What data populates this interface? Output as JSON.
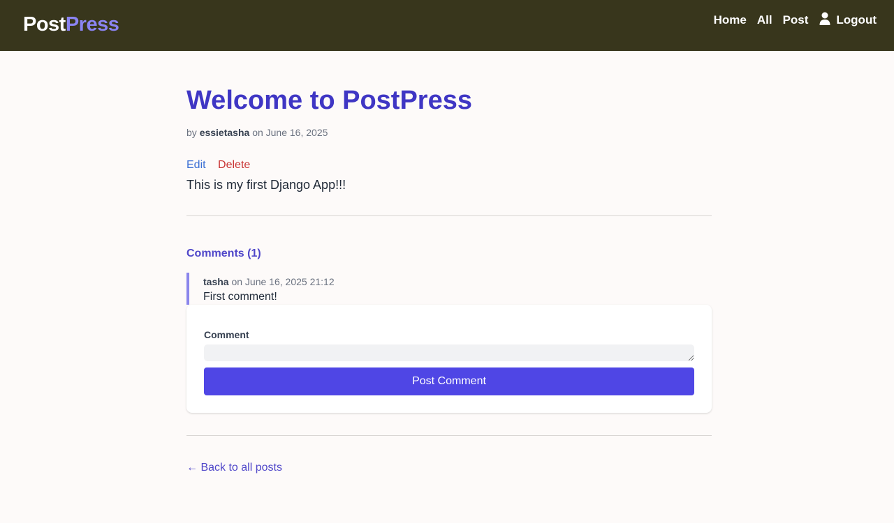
{
  "navbar": {
    "brand_part1": "Post",
    "brand_part2": "Press",
    "links": {
      "home": "Home",
      "all": "All",
      "post": "Post",
      "logout": "Logout"
    },
    "user_icon": "user-icon",
    "colors": {
      "background": "#38361c",
      "brand_accent": "#8b84f2"
    }
  },
  "post": {
    "title": "Welcome to PostPress",
    "by_label": "by",
    "author": "essietasha",
    "date_label": "on June 16, 2025",
    "edit_label": "Edit",
    "delete_label": "Delete",
    "body": "This is my first Django App!!!"
  },
  "comments": {
    "heading": "Comments (1)",
    "items": [
      {
        "author": "tasha",
        "date": "on June 16, 2025 21:12",
        "text": "First comment!"
      }
    ]
  },
  "comment_form": {
    "label": "Comment",
    "value": "",
    "submit_label": "Post Comment",
    "button_color": "#4f46e5"
  },
  "footer": {
    "back_link": "← Back to all posts"
  }
}
